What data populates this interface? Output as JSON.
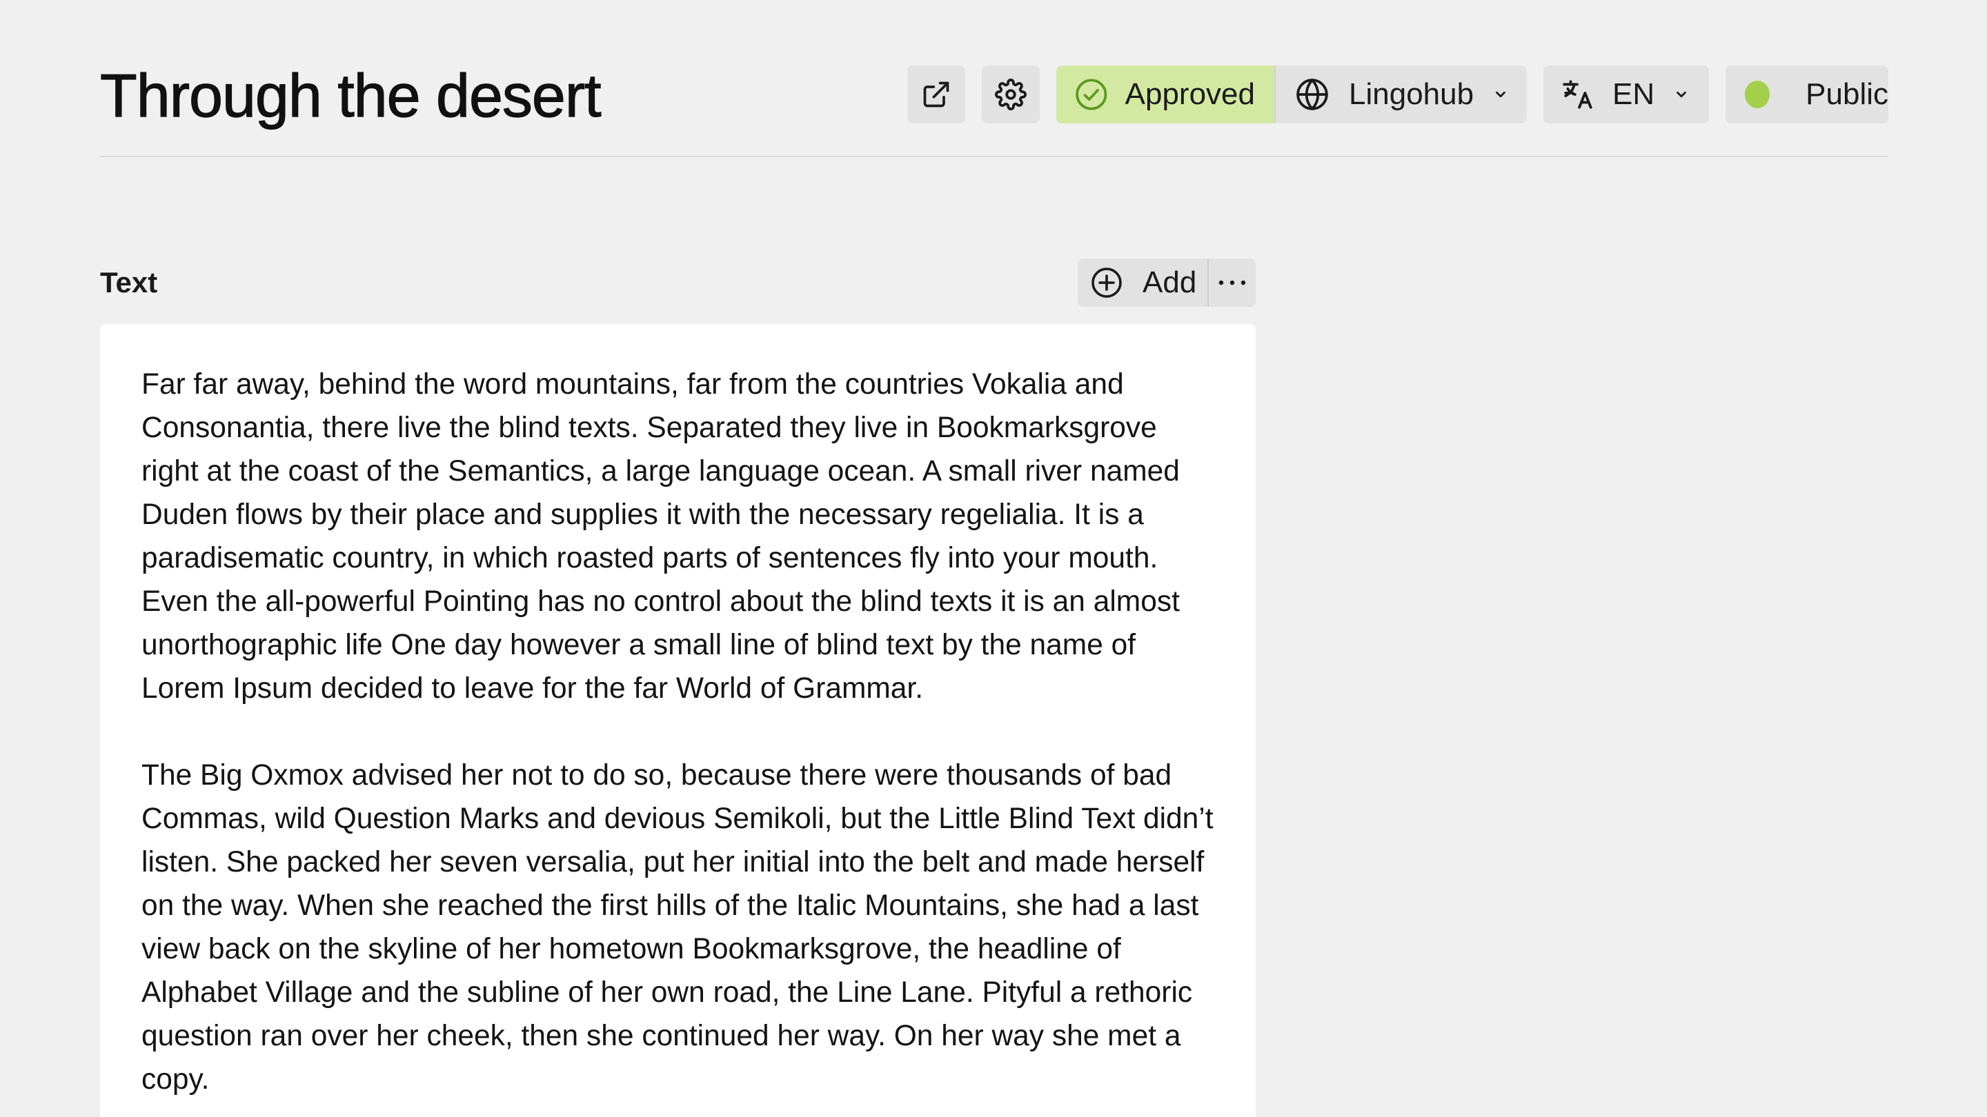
{
  "header": {
    "title": "Through the desert"
  },
  "toolbar": {
    "open_external_icon": "external-link-icon",
    "settings_icon": "gear-icon",
    "status": {
      "label": "Approved",
      "icon": "check-circle-icon",
      "color": "#d3e9a2"
    },
    "provider": {
      "label": "Lingohub",
      "icon": "globe-icon"
    },
    "language": {
      "label": "EN",
      "icon": "translate-icon"
    },
    "visibility": {
      "label": "Public",
      "dot_color": "#a3cf4a"
    }
  },
  "section": {
    "label": "Text",
    "add_label": "Add",
    "more_icon": "ellipsis-icon"
  },
  "content": {
    "paragraphs": [
      "Far far away, behind the word mountains, far from the countries Vokalia and Consonantia, there live the blind texts. Separated they live in Bookmarksgrove right at the coast of the Semantics, a large language ocean. A small river named Duden flows by their place and supplies it with the necessary regelialia. It is a paradisematic country, in which roasted parts of sentences fly into your mouth. Even the all-powerful Pointing has no control about the blind texts it is an almost unorthographic life One day however a small line of blind text by the name of Lorem Ipsum decided to leave for the far World of Grammar.",
      "The Big Oxmox advised her not to do so, because there were thousands of bad Commas, wild Question Marks and devious Semikoli, but the Little Blind Text didn’t listen. She packed her seven versalia, put her initial into the belt and made herself on the way. When she reached the first hills of the Italic Mountains, she had a last view back on the skyline of her hometown Bookmarksgrove, the headline of Alphabet Village and the subline of her own road, the Line Lane. Pityful a rethoric question ran over her cheek, then she continued her way. On her way she met a copy."
    ]
  }
}
